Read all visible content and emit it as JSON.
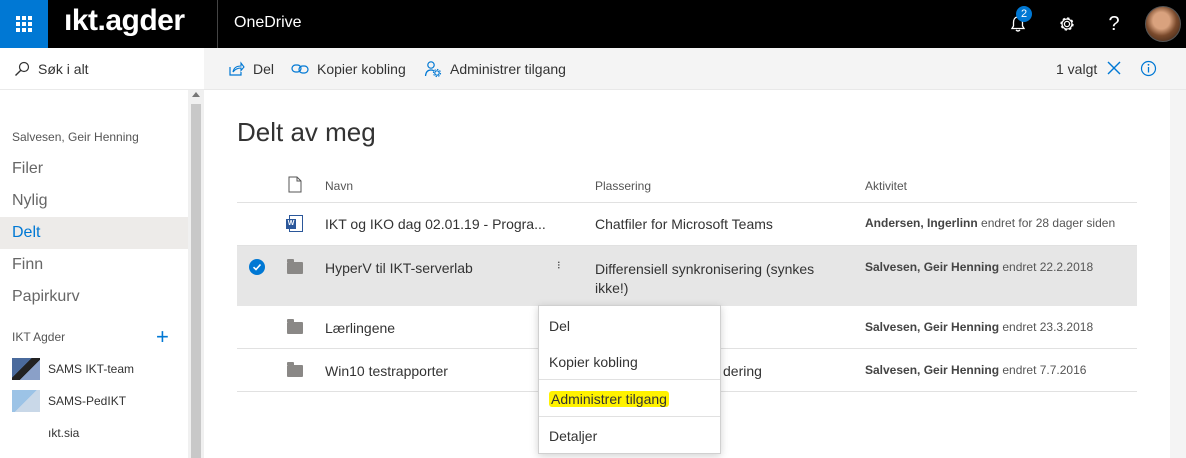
{
  "topbar": {
    "brand": "ıkt.agder",
    "app_name": "OneDrive",
    "notifications_count": "2",
    "help_label": "?"
  },
  "leftnav": {
    "search_label": "Søk i alt",
    "user_name": "Salvesen, Geir Henning",
    "items": [
      {
        "label": "Filer"
      },
      {
        "label": "Nylig"
      },
      {
        "label": "Delt"
      },
      {
        "label": "Finn"
      },
      {
        "label": "Papirkurv"
      }
    ],
    "active_item": "Delt",
    "group_label": "IKT Agder",
    "add_label": "+",
    "sites": [
      {
        "label": "SAMS IKT-team"
      },
      {
        "label": "SAMS-PedIKT"
      },
      {
        "label": "ıkt.sia"
      }
    ]
  },
  "cmdbar": {
    "share_label": "Del",
    "copy_link_label": "Kopier kobling",
    "manage_access_label": "Administrer tilgang",
    "selected_count": "1 valgt"
  },
  "main": {
    "title": "Delt av meg",
    "columns": {
      "name": "Navn",
      "location": "Plassering",
      "activity": "Aktivitet"
    },
    "rows": [
      {
        "name": "IKT og IKO dag 02.01.19 - Progra...",
        "location": "Chatfiler for Microsoft Teams",
        "activity_user": "Andersen, Ingerlinn",
        "activity_text": " endret for 28 dager siden",
        "type": "word"
      },
      {
        "name": "HyperV til IKT-serverlab",
        "location": "Differensiell synkronisering (synkes ikke!)",
        "activity_user": "Salvesen, Geir Henning",
        "activity_text": " endret 22.2.2018",
        "type": "folder",
        "selected": true
      },
      {
        "name": "Lærlingene",
        "location": "",
        "activity_user": "Salvesen, Geir Henning",
        "activity_text": " endret 23.3.2018",
        "type": "folder"
      },
      {
        "name": "Win10 testrapporter",
        "location": "dering",
        "activity_user": "Salvesen, Geir Henning",
        "activity_text": " endret 7.7.2016",
        "type": "folder"
      }
    ]
  },
  "context_menu": {
    "items": [
      {
        "label": "Del"
      },
      {
        "label": "Kopier kobling"
      },
      {
        "label": "Administrer tilgang"
      },
      {
        "label": "Detaljer"
      }
    ],
    "highlight_color": "#fff200"
  },
  "colors": {
    "accent": "#0078d4",
    "topbar": "#000000"
  }
}
